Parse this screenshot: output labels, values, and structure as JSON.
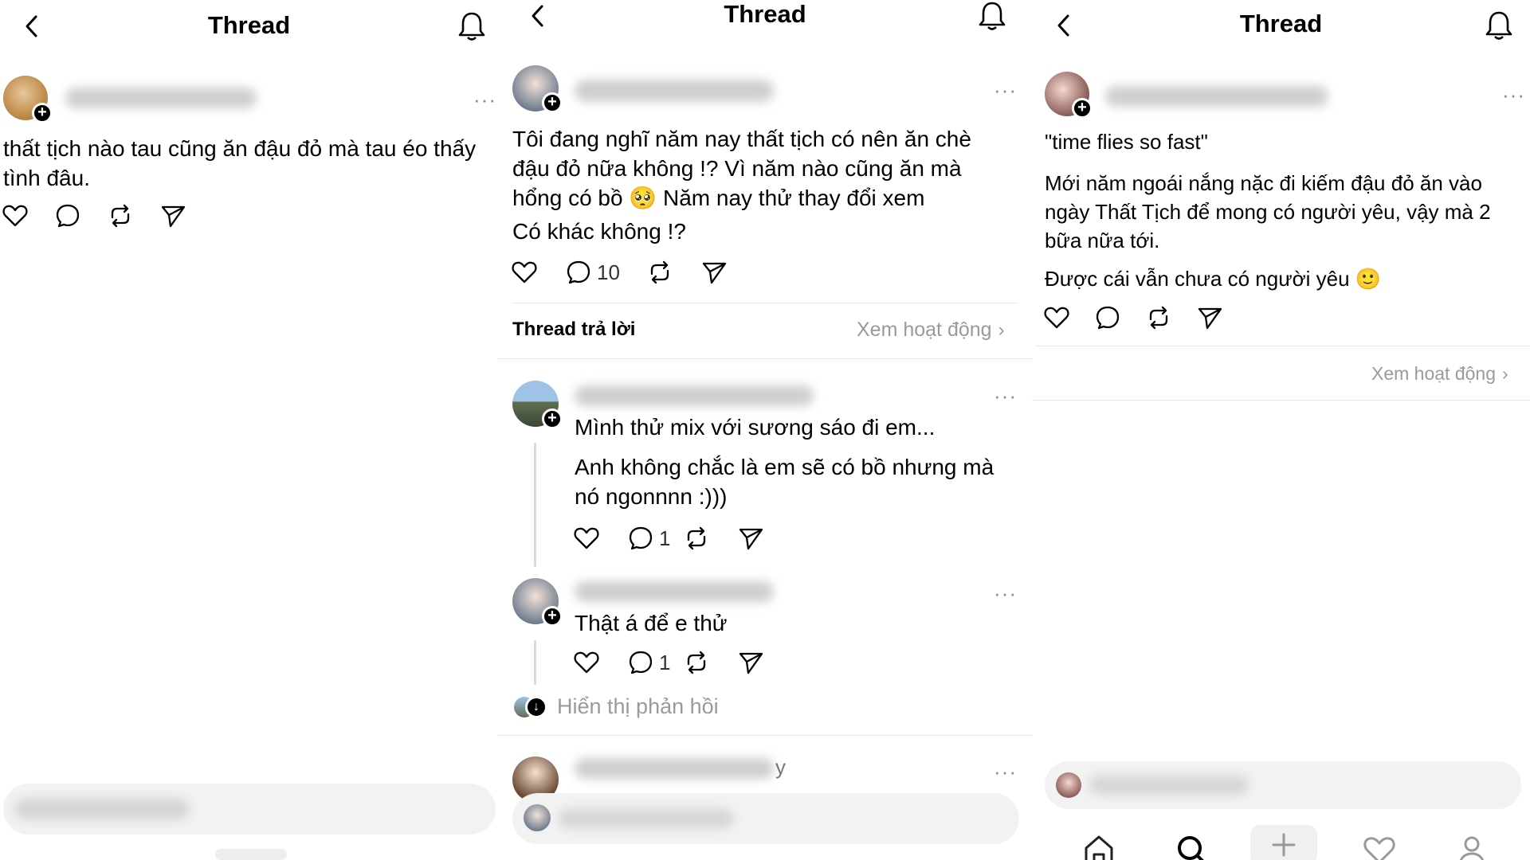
{
  "panels": [
    {
      "title": "Thread",
      "post": {
        "text": "thất tịch nào tau cũng ăn đậu đỏ mà tau éo thấy tình đâu."
      }
    },
    {
      "title": "Thread",
      "post": {
        "text": "Tôi đang nghĩ năm nay thất tịch có nên ăn chè đậu đỏ nữa không !? Vì năm nào cũng ăn mà hổng có bồ 🥺 Năm nay thử thay đổi xem",
        "text2": "Có khác không !?",
        "reply_count": "10"
      },
      "section": {
        "label": "Thread trả lời",
        "activity_link": "Xem hoạt động"
      },
      "replies": [
        {
          "line1": "Mình thử mix với sương sáo đi em...",
          "line2": "Anh không chắc là em sẽ có bồ nhưng mà nó ngonnnn :)))",
          "reply_count": "1"
        },
        {
          "line1": "Thật á để e thử",
          "reply_count": "1"
        }
      ],
      "show_replies": "Hiển thị phản hồi",
      "partial_user_tail": "y"
    },
    {
      "title": "Thread",
      "post": {
        "quote": "\"time flies so fast\"",
        "text": "Mới năm ngoái nắng nặc đi kiếm đậu đỏ ăn vào ngày Thất Tịch để mong có người yêu, vậy mà 2 bữa nữa tới.",
        "text2": "Được cái vẫn chưa có người yêu 🙂"
      },
      "activity_link": "Xem hoạt động"
    }
  ],
  "icons": {
    "back": "chevron-left-icon",
    "bell": "bell-icon",
    "like": "heart-icon",
    "comment": "comment-bubble-icon",
    "repost": "repost-icon",
    "share": "send-icon",
    "more": "more-dots-icon",
    "home": "home-icon",
    "search": "search-icon",
    "new": "plus-icon",
    "activity": "heart-icon",
    "profile": "person-icon"
  },
  "colors": {
    "text": "#000000",
    "muted": "#9a9a9a",
    "divider": "#e6e6e6",
    "composer": "#f2f2f2"
  }
}
